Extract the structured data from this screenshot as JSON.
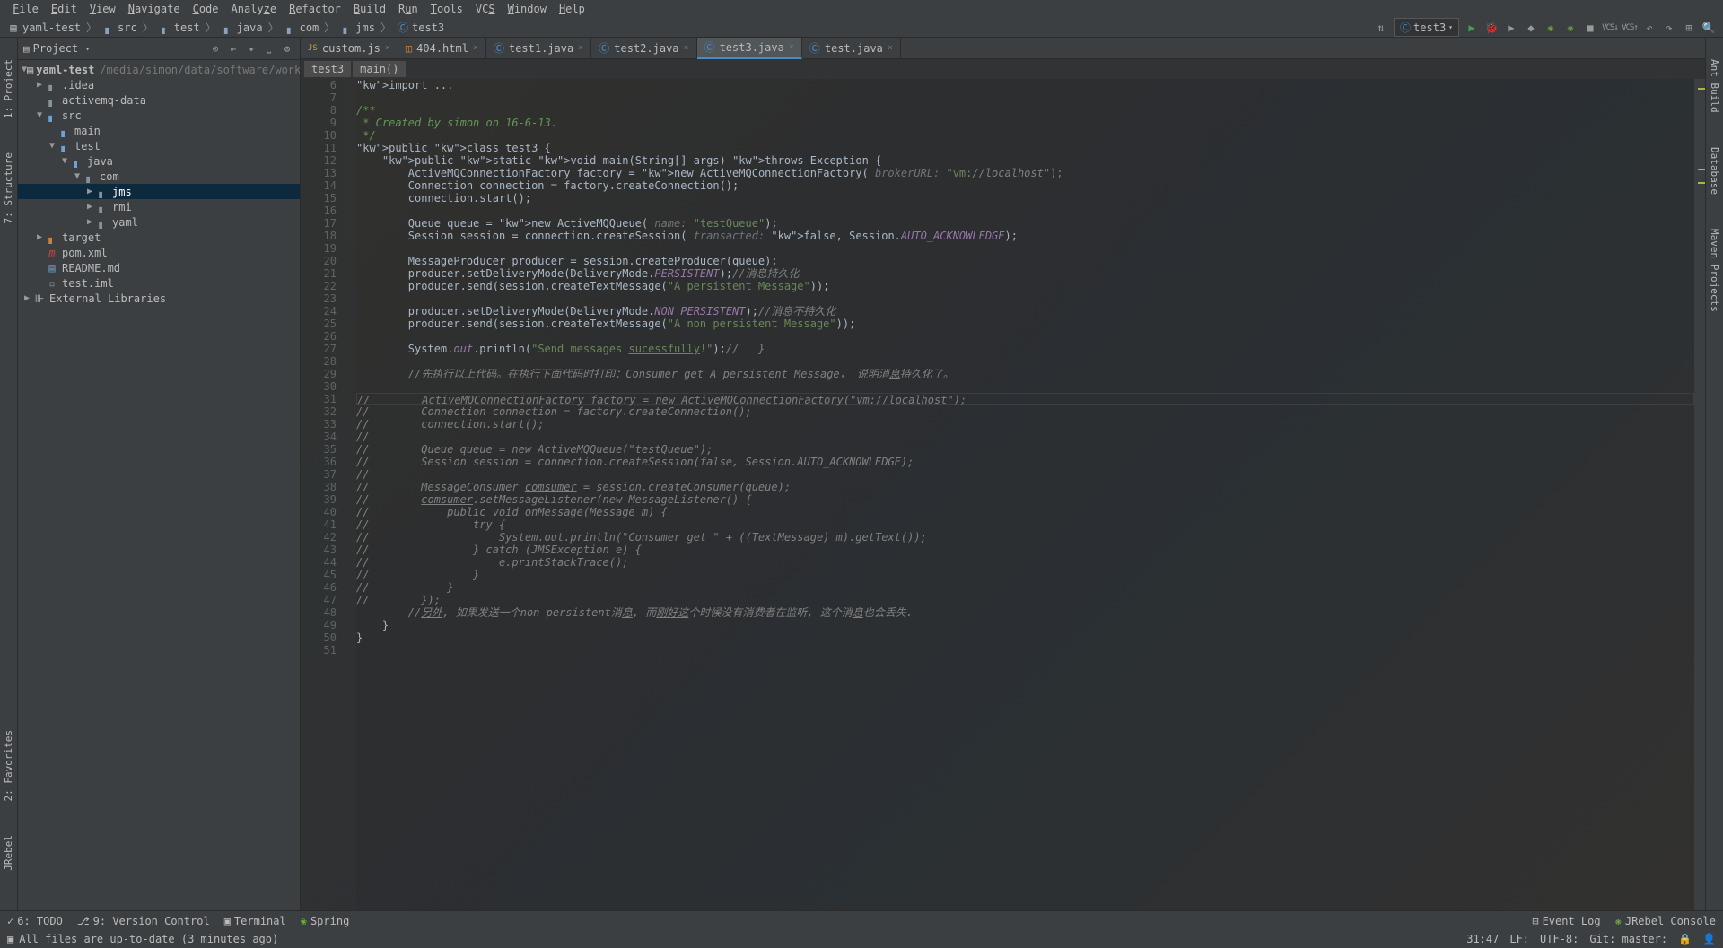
{
  "menu": [
    "File",
    "Edit",
    "View",
    "Navigate",
    "Code",
    "Analyze",
    "Refactor",
    "Build",
    "Run",
    "Tools",
    "VCS",
    "Window",
    "Help"
  ],
  "breadcrumbs": [
    {
      "icon": "project",
      "label": "yaml-test"
    },
    {
      "icon": "folder",
      "label": "src"
    },
    {
      "icon": "folder",
      "label": "test"
    },
    {
      "icon": "folder-java",
      "label": "java"
    },
    {
      "icon": "folder",
      "label": "com"
    },
    {
      "icon": "folder",
      "label": "jms"
    },
    {
      "icon": "class",
      "label": "test3"
    }
  ],
  "run_config": "test3",
  "project": {
    "title": "Project",
    "root": {
      "label": "yaml-test",
      "path": "/media/simon/data/software/workspa..."
    },
    "tree": [
      {
        "d": 1,
        "arrow": "▶",
        "icon": "folder",
        "label": ".idea"
      },
      {
        "d": 1,
        "arrow": "",
        "icon": "folder",
        "label": "activemq-data"
      },
      {
        "d": 1,
        "arrow": "▼",
        "icon": "folder-blue",
        "label": "src"
      },
      {
        "d": 2,
        "arrow": "",
        "icon": "folder-blue",
        "label": "main"
      },
      {
        "d": 2,
        "arrow": "▼",
        "icon": "folder-blue",
        "label": "test"
      },
      {
        "d": 3,
        "arrow": "▼",
        "icon": "folder-java",
        "label": "java"
      },
      {
        "d": 4,
        "arrow": "▼",
        "icon": "package",
        "label": "com"
      },
      {
        "d": 5,
        "arrow": "▶",
        "icon": "package",
        "label": "jms",
        "selected": true
      },
      {
        "d": 5,
        "arrow": "▶",
        "icon": "package",
        "label": "rmi"
      },
      {
        "d": 5,
        "arrow": "▶",
        "icon": "package",
        "label": "yaml"
      },
      {
        "d": 1,
        "arrow": "▶",
        "icon": "folder-orange",
        "label": "target"
      },
      {
        "d": 1,
        "arrow": "",
        "icon": "maven",
        "label": "pom.xml"
      },
      {
        "d": 1,
        "arrow": "",
        "icon": "md",
        "label": "README.md"
      },
      {
        "d": 1,
        "arrow": "",
        "icon": "file",
        "label": "test.iml"
      }
    ],
    "external": "External Libraries"
  },
  "tabs": [
    {
      "icon": "js",
      "label": "custom.js"
    },
    {
      "icon": "html",
      "label": "404.html"
    },
    {
      "icon": "class",
      "label": "test1.java"
    },
    {
      "icon": "class",
      "label": "test2.java"
    },
    {
      "icon": "class",
      "label": "test3.java",
      "active": true
    },
    {
      "icon": "class",
      "label": "test.java"
    }
  ],
  "crumbs": [
    "test3",
    "main()"
  ],
  "gutter_start": 6,
  "gutter_end": 51,
  "code": [
    {
      "t": "import ...",
      "cls": "import"
    },
    {
      "t": "",
      "cls": ""
    },
    {
      "t": "/**",
      "cls": "doc"
    },
    {
      "t": " * Created by simon on 16-6-13.",
      "cls": "doc"
    },
    {
      "t": " */",
      "cls": "doc"
    },
    {
      "t": "public class test3 {",
      "cls": "decl"
    },
    {
      "t": "    public static void main(String[] args) throws Exception {",
      "cls": "decl2"
    },
    {
      "t": "        ActiveMQConnectionFactory factory = new ActiveMQConnectionFactory( brokerURL: \"vm://localhost\");",
      "cls": ""
    },
    {
      "t": "        Connection connection = factory.createConnection();",
      "cls": ""
    },
    {
      "t": "        connection.start();",
      "cls": ""
    },
    {
      "t": "",
      "cls": ""
    },
    {
      "t": "        Queue queue = new ActiveMQQueue( name: \"testQueue\");",
      "cls": ""
    },
    {
      "t": "        Session session = connection.createSession( transacted: false, Session.AUTO_ACKNOWLEDGE);",
      "cls": ""
    },
    {
      "t": "",
      "cls": ""
    },
    {
      "t": "        MessageProducer producer = session.createProducer(queue);",
      "cls": ""
    },
    {
      "t": "        producer.setDeliveryMode(DeliveryMode.PERSISTENT);//消息持久化",
      "cls": ""
    },
    {
      "t": "        producer.send(session.createTextMessage(\"A persistent Message\"));",
      "cls": ""
    },
    {
      "t": "",
      "cls": ""
    },
    {
      "t": "        producer.setDeliveryMode(DeliveryMode.NON_PERSISTENT);//消息不持久化",
      "cls": ""
    },
    {
      "t": "        producer.send(session.createTextMessage(\"A non persistent Message\"));",
      "cls": ""
    },
    {
      "t": "",
      "cls": ""
    },
    {
      "t": "        System.out.println(\"Send messages sucessfully!\");//   }",
      "cls": ""
    },
    {
      "t": "",
      "cls": ""
    },
    {
      "t": "        //先执行以上代码。在执行下面代码时打印：Consumer get A persistent Message， 说明消息持久化了。",
      "cls": "cmt"
    },
    {
      "t": "",
      "cls": "",
      "bulb": true
    },
    {
      "t": "//        ActiveMQConnectionFactory factory = new ActiveMQConnectionFactory(\"vm://localhost\");",
      "cls": "cmt",
      "cursor": true
    },
    {
      "t": "//        Connection connection = factory.createConnection();",
      "cls": "cmt"
    },
    {
      "t": "//        connection.start();",
      "cls": "cmt"
    },
    {
      "t": "//",
      "cls": "cmt"
    },
    {
      "t": "//        Queue queue = new ActiveMQQueue(\"testQueue\");",
      "cls": "cmt"
    },
    {
      "t": "//        Session session = connection.createSession(false, Session.AUTO_ACKNOWLEDGE);",
      "cls": "cmt"
    },
    {
      "t": "//",
      "cls": "cmt"
    },
    {
      "t": "//        MessageConsumer comsumer = session.createConsumer(queue);",
      "cls": "cmt"
    },
    {
      "t": "//        comsumer.setMessageListener(new MessageListener() {",
      "cls": "cmt"
    },
    {
      "t": "//            public void onMessage(Message m) {",
      "cls": "cmt"
    },
    {
      "t": "//                try {",
      "cls": "cmt"
    },
    {
      "t": "//                    System.out.println(\"Consumer get \" + ((TextMessage) m).getText());",
      "cls": "cmt"
    },
    {
      "t": "//                } catch (JMSException e) {",
      "cls": "cmt"
    },
    {
      "t": "//                    e.printStackTrace();",
      "cls": "cmt"
    },
    {
      "t": "//                }",
      "cls": "cmt"
    },
    {
      "t": "//            }",
      "cls": "cmt"
    },
    {
      "t": "//        });",
      "cls": "cmt"
    },
    {
      "t": "        //另外, 如果发送一个non persistent消息, 而刚好这个时候没有消费者在监听, 这个消息也会丢失.",
      "cls": "cmt"
    },
    {
      "t": "    }",
      "cls": ""
    },
    {
      "t": "}",
      "cls": ""
    },
    {
      "t": "",
      "cls": ""
    }
  ],
  "left_tabs": [
    "1: Project",
    "7: Structure"
  ],
  "left_tabs_bottom": [
    "2: Favorites",
    "JRebel"
  ],
  "right_tabs": [
    "Ant Build",
    "Database",
    "Maven Projects"
  ],
  "bottom": {
    "left": [
      {
        "icon": "todo",
        "label": "6: TODO"
      },
      {
        "icon": "vcs",
        "label": "9: Version Control"
      },
      {
        "icon": "terminal",
        "label": "Terminal"
      },
      {
        "icon": "spring",
        "label": "Spring"
      }
    ],
    "right": [
      {
        "icon": "log",
        "label": "Event Log"
      },
      {
        "icon": "jrebel",
        "label": "JRebel Console"
      }
    ]
  },
  "status": {
    "message": "All files are up-to-date (3 minutes ago)",
    "pos": "31:47",
    "lf": "LF:",
    "enc": "UTF-8:",
    "git": "Git: master:"
  }
}
